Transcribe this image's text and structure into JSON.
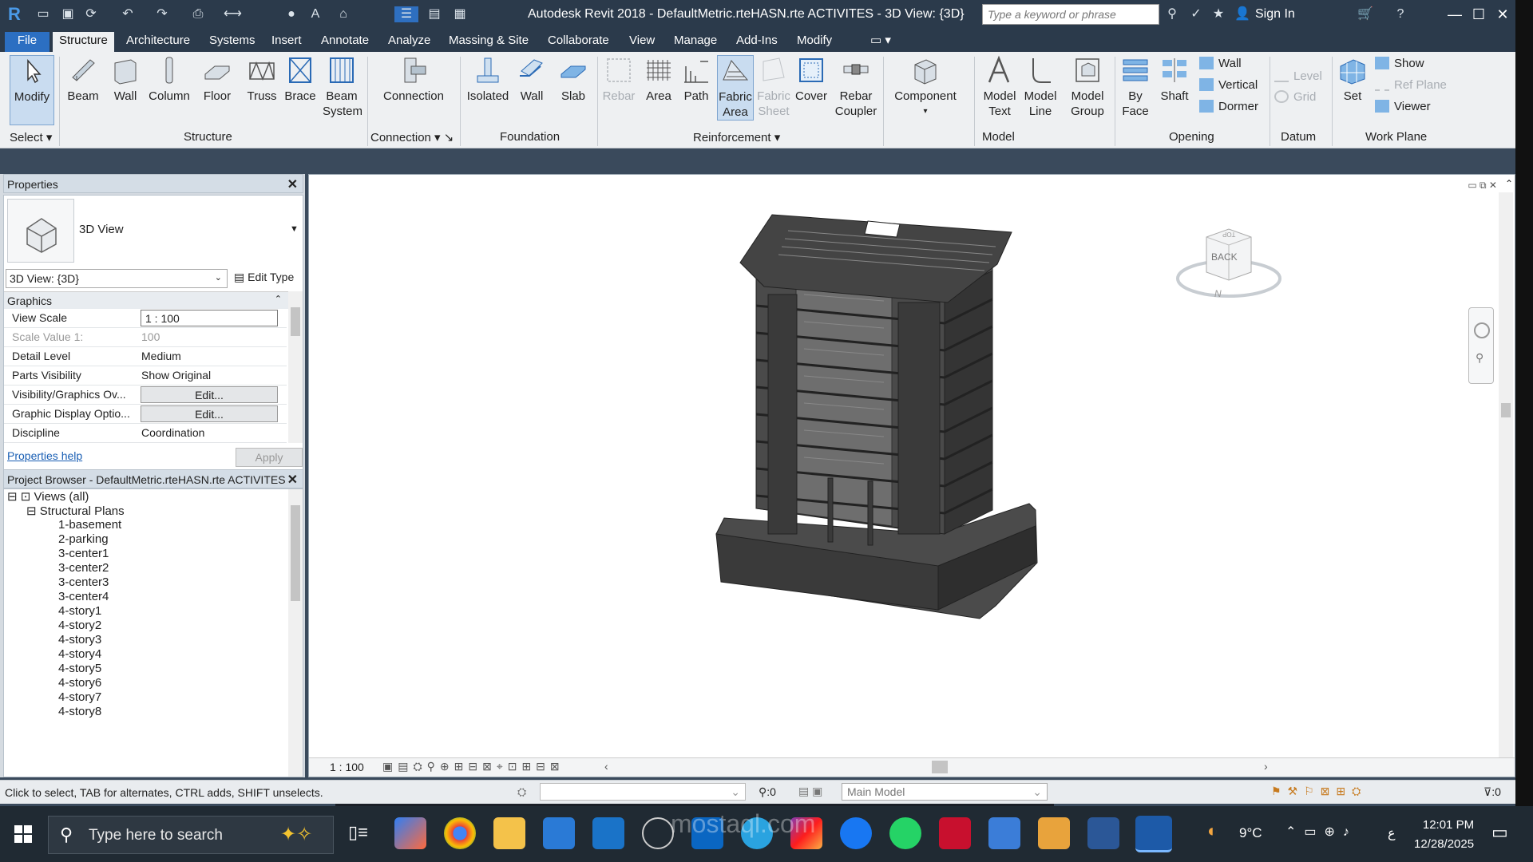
{
  "titlebar": {
    "title": "Autodesk Revit 2018 -     DefaultMetric.rteHASN.rte ACTIVITES - 3D View: {3D}",
    "search_placeholder": "Type a keyword or phrase",
    "sign_in": "Sign In"
  },
  "menu": {
    "file": "File",
    "tabs": [
      "Structure",
      "Architecture",
      "Systems",
      "Insert",
      "Annotate",
      "Analyze",
      "Massing & Site",
      "Collaborate",
      "View",
      "Manage",
      "Add-Ins",
      "Modify"
    ]
  },
  "ribbon": {
    "select": {
      "modify": "Modify",
      "group": "Select"
    },
    "structure": {
      "beam": "Beam",
      "wall": "Wall",
      "column": "Column",
      "floor": "Floor",
      "truss": "Truss",
      "brace": "Brace",
      "beam_system": "Beam\nSystem",
      "group": "Structure"
    },
    "connection": {
      "connection": "Connection",
      "group": "Connection"
    },
    "foundation": {
      "isolated": "Isolated",
      "wall": "Wall",
      "slab": "Slab",
      "group": "Foundation"
    },
    "reinforcement": {
      "rebar": "Rebar",
      "area": "Area",
      "path": "Path",
      "fabric_area": "Fabric\nArea",
      "fabric_sheet": "Fabric\nSheet",
      "cover": "Cover",
      "rebar_coupler": "Rebar\nCoupler",
      "group": "Reinforcement"
    },
    "component": {
      "label": "Component"
    },
    "model": {
      "model_text": "Model\nText",
      "model_line": "Model\nLine",
      "model_group": "Model\nGroup",
      "group": "Model"
    },
    "opening": {
      "by_face": "By\nFace",
      "shaft": "Shaft",
      "wall": "Wall",
      "vertical": "Vertical",
      "dormer": "Dormer",
      "group": "Opening"
    },
    "datum": {
      "level": "Level",
      "grid": "Grid",
      "group": "Datum"
    },
    "work_plane": {
      "set": "Set",
      "show": "Show",
      "ref_plane": "Ref  Plane",
      "viewer": "Viewer",
      "group": "Work Plane"
    }
  },
  "properties": {
    "title": "Properties",
    "type_name": "3D View",
    "instance_selector": "3D View: {3D}",
    "edit_type": "Edit Type",
    "section": "Graphics",
    "rows": [
      {
        "key": "View Scale",
        "value": "1 : 100"
      },
      {
        "key": "Scale Value    1:",
        "value": "100"
      },
      {
        "key": "Detail Level",
        "value": "Medium"
      },
      {
        "key": "Parts Visibility",
        "value": "Show Original"
      },
      {
        "key": "Visibility/Graphics Ov...",
        "value": "Edit..."
      },
      {
        "key": "Graphic Display Optio...",
        "value": "Edit..."
      },
      {
        "key": "Discipline",
        "value": "Coordination"
      }
    ],
    "help": "Properties help",
    "apply": "Apply"
  },
  "browser": {
    "title": "Project Browser - DefaultMetric.rteHASN.rte ACTIVITES",
    "root": "Views (all)",
    "group": "Structural Plans",
    "items": [
      "1-basement",
      "2-parking",
      "3-center1",
      "3-center2",
      "3-center3",
      "3-center4",
      "4-story1",
      "4-story2",
      "4-story3",
      "4-story4",
      "4-story5",
      "4-story6",
      "4-story7",
      "4-story8"
    ]
  },
  "viewport": {
    "scale": "1 : 100",
    "viewcube_face": "BACK",
    "viewcube_top": "TOP",
    "compass_n": "N"
  },
  "status": {
    "hint": "Click to select, TAB for alternates, CTRL adds, SHIFT unselects.",
    "zero_a": ":0",
    "model": "Main Model",
    "zero_b": ":0"
  },
  "taskbar": {
    "search": "Type here to search",
    "temperature": "9°C",
    "lang": "ع",
    "time": "12:01 PM",
    "date": "12/28/2025"
  },
  "watermark": "mostaql.com"
}
